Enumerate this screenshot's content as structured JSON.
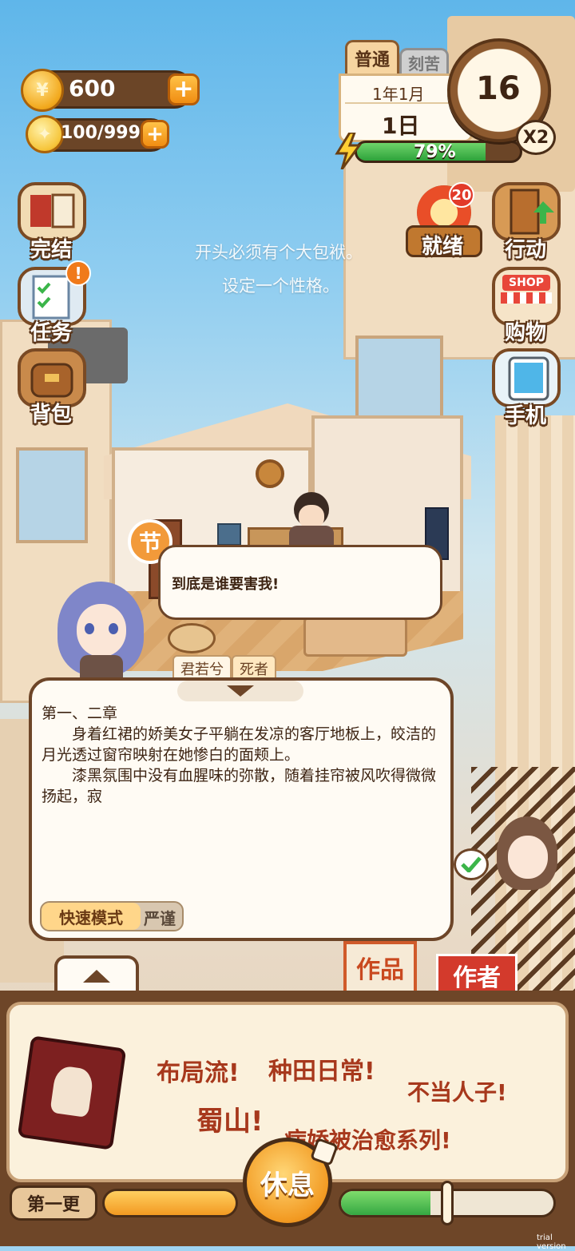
{
  "hud": {
    "coins": "600",
    "energy": "100/999"
  },
  "left_menu": {
    "finish": "完结",
    "tasks": "任务",
    "bag": "背包"
  },
  "right_menu": {
    "ready": "就绪",
    "ready_badge": "20",
    "action": "行动",
    "shop_sign": "SHOP",
    "shop": "购物",
    "phone": "手机"
  },
  "calendar": {
    "difficulty": "普通",
    "tab2": "刻苦",
    "year_month": "1年1月",
    "day": "1日",
    "day_count": "16",
    "speed": "X2",
    "progress_text": "79%",
    "progress": 0.79
  },
  "hints": {
    "line1": "开头必须有个大包袱。",
    "line2": "设定一个性格。"
  },
  "scene": {
    "section_badge": "节",
    "speech_text": "到底是谁要害我!",
    "character_name": "君若兮",
    "character_role": "死者"
  },
  "story": {
    "heading": "第一、二章",
    "para1": "身着红裙的娇美女子平躺在发凉的客厅地板上，皎洁的月光透过窗帘映射在她惨白的面颊上。",
    "para2": "漆黑氛围中没有血腥味的弥散，随着挂帘被风吹得微微扬起，寂",
    "mode_fast": "快速模式",
    "mode_strict": "严谨"
  },
  "tabs": {
    "works": "作品",
    "author": "作者"
  },
  "board": {
    "tag1": "布局流!",
    "tag2": "种田日常!",
    "tag3": "不当人子!",
    "tag4": "蜀山!",
    "tag5": "病娇被治愈系列!"
  },
  "footer": {
    "chapter": "第一更",
    "rest": "休息",
    "left_progress": 1.0,
    "right_progress": 0.42,
    "watermark": "trial version"
  },
  "colors": {
    "accent": "#f2a81c",
    "brown": "#6e4628",
    "green": "#3bb54a",
    "tag_red": "#a7381c"
  }
}
